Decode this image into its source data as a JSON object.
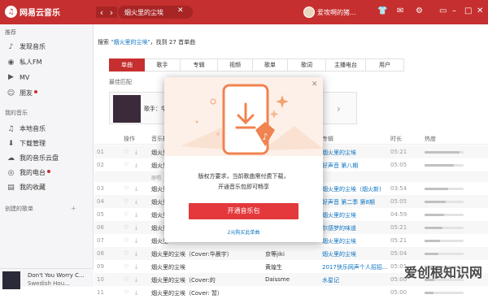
{
  "app": {
    "name": "网易云音乐"
  },
  "topbar": {
    "search_value": "烟火里的尘埃",
    "username": "爱攻啊的猪...",
    "icons": [
      "back-icon",
      "forward-icon",
      "clear-icon",
      "shirt-icon",
      "mail-icon",
      "settings-icon",
      "minimize-icon",
      "maximize-icon",
      "close-icon"
    ]
  },
  "sidebar": {
    "recommend_title": "推荐",
    "recommend_items": [
      "发现音乐",
      "私人FM",
      "MV",
      "朋友"
    ],
    "my_music_title": "我的音乐",
    "my_music_items": [
      "本地音乐",
      "下载管理",
      "我的音乐云盘",
      "我的电台",
      "我的收藏"
    ],
    "created_title": "创建的歌单",
    "created_add": "+"
  },
  "player": {
    "title": "Don't You Worry C...",
    "artist": "Swedish Hou..."
  },
  "search_result": {
    "prefix": "搜索 ",
    "keyword": "\"烟火里的尘埃\"",
    "middle": "，找到 ",
    "count": "27",
    "suffix": " 首单曲"
  },
  "tabs": [
    {
      "label": "单曲",
      "active": true
    },
    {
      "label": "歌手",
      "active": false
    },
    {
      "label": "专辑",
      "active": false
    },
    {
      "label": "视频",
      "active": false
    },
    {
      "label": "歌单",
      "active": false
    },
    {
      "label": "歌词",
      "active": false
    },
    {
      "label": "主播电台",
      "active": false
    },
    {
      "label": "用户",
      "active": false
    }
  ],
  "best_match": {
    "title": "最佳匹配",
    "singer_label": "歌手：华"
  },
  "table": {
    "headers": {
      "op": "操作",
      "title": "音乐标",
      "album": "专辑",
      "duration": "时长",
      "popularity": "热度"
    },
    "rows": [
      {
        "num": "01",
        "title": "烟火里",
        "album": "烟火里的尘埃",
        "duration": "05:21",
        "pop": 0.9
      },
      {
        "num": "02",
        "title": "烟火里",
        "album": "好声音 第八期",
        "duration": "05:05",
        "pop": 0.75
      },
      {
        "num": "",
        "title": "原唱",
        "album": "",
        "duration": "",
        "pop": null
      },
      {
        "num": "03",
        "title": "烟火里",
        "album": "烟火里的尘埃（烟火新)",
        "duration": "03:54",
        "pop": 0.6
      },
      {
        "num": "04",
        "title": "烟火里",
        "album": "好声音 第二季 第8期",
        "duration": "05:05",
        "pop": 0.55
      },
      {
        "num": "05",
        "title": "烟火里",
        "album": "烟火里的尘埃",
        "duration": "04:59",
        "pop": 0.5
      },
      {
        "num": "06",
        "title": "烟火里",
        "album": "尔感梦的味道",
        "duration": "05:21",
        "pop": 0.45
      },
      {
        "num": "07",
        "title": "烟火里",
        "album": "烟火里的尘埃",
        "duration": "05:21",
        "pop": 0.4
      },
      {
        "num": "08",
        "title": "烟火里的尘埃（Cover:华晨宇）",
        "artist": "京等jiki",
        "album": "烟火里的尘埃",
        "duration": "05:04",
        "pop": 0.35
      },
      {
        "num": "09",
        "title": "烟火里的尘埃",
        "artist": "黄煌生",
        "album": "2017快乐网声个人招招...",
        "duration": "05:01",
        "pop": 0.3
      },
      {
        "num": "10",
        "title": "烟火里的尘埃（Cover:的",
        "artist": "Daissme",
        "album": "水星记",
        "duration": "05:00",
        "pop": 0.25
      },
      {
        "num": "11",
        "title": "烟火里的尘埃（Cover: 暂）",
        "artist": "",
        "album": "",
        "duration": "05:00",
        "pop": 0.22
      }
    ]
  },
  "modal": {
    "line1": "版权方要求，当前歌曲需付费下载，",
    "line2": "开通音乐包即可畅享",
    "button": "开通音乐包",
    "link": "2元购买此单曲"
  },
  "watermark": "爱创根知识网",
  "colors": {
    "brand": "#c62f2f",
    "link": "#0c73c2",
    "modal_button": "#e4393c"
  }
}
